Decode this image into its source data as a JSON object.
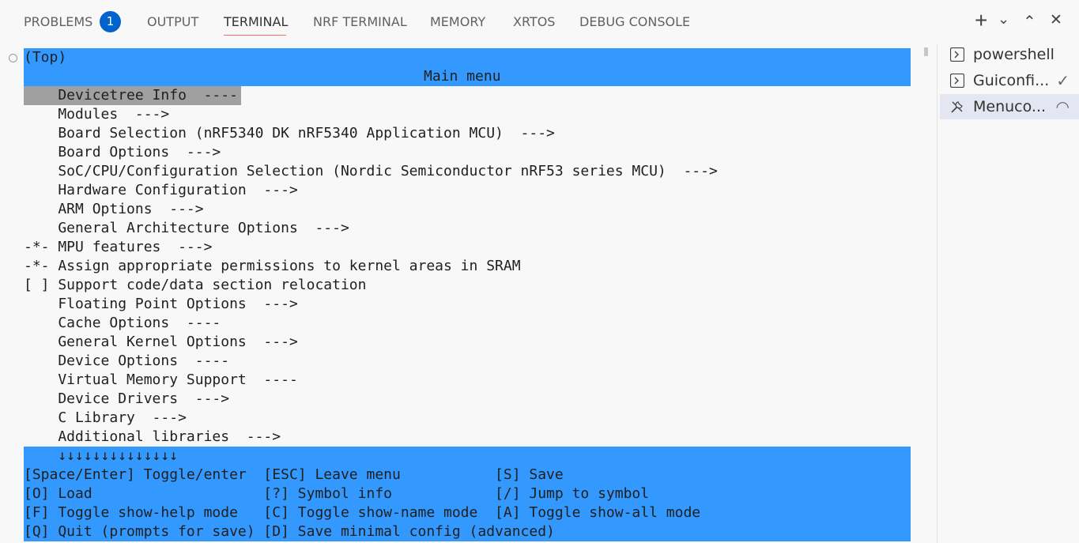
{
  "panel": {
    "tabs": [
      "PROBLEMS",
      "OUTPUT",
      "TERMINAL",
      "NRF TERMINAL",
      "MEMORY",
      "XRTOS",
      "DEBUG CONSOLE"
    ],
    "active_tab": "TERMINAL",
    "problems_count": "1",
    "controls": {
      "add": "+",
      "dropdown": "⌄",
      "maximize": "⌃",
      "close": "✕"
    }
  },
  "terminal": {
    "header": {
      "top": "(Top)",
      "title": "Main menu"
    },
    "menu_items": [
      "    Devicetree Info  ----",
      "    Modules  --->",
      "    Board Selection (nRF5340 DK nRF5340 Application MCU)  --->",
      "    Board Options  --->",
      "    SoC/CPU/Configuration Selection (Nordic Semiconductor nRF53 series MCU)  --->",
      "    Hardware Configuration  --->",
      "    ARM Options  --->",
      "    General Architecture Options  --->",
      "-*- MPU features  --->",
      "-*- Assign appropriate permissions to kernel areas in SRAM",
      "[ ] Support code/data section relocation",
      "    Floating Point Options  --->",
      "    Cache Options  ----",
      "    General Kernel Options  --->",
      "    Device Options  ----",
      "    Virtual Memory Support  ----",
      "    Device Drivers  --->",
      "    C Library  --->",
      "    Additional libraries  --->"
    ],
    "scroll_indicator": "    ↓↓↓↓↓↓↓↓↓↓↓↓↓↓",
    "help_lines": [
      "[Space/Enter] Toggle/enter  [ESC] Leave menu           [S] Save",
      "[O] Load                    [?] Symbol info            [/] Jump to symbol",
      "[F] Toggle show-help mode   [C] Toggle show-name mode  [A] Toggle show-all mode",
      "[Q] Quit (prompts for save) [D] Save minimal config (advanced)"
    ]
  },
  "terminal_list": [
    {
      "label": "powershell",
      "icon": "terminal-icon",
      "status": ""
    },
    {
      "label": "Guiconfi...",
      "icon": "terminal-icon",
      "status": "✓"
    },
    {
      "label": "Menuco...",
      "icon": "tools-icon",
      "status": "◠"
    }
  ],
  "colors": {
    "accent_blue": "#3399ff",
    "selection_gray": "#a0a0a0",
    "badge_blue": "#0063cc"
  }
}
